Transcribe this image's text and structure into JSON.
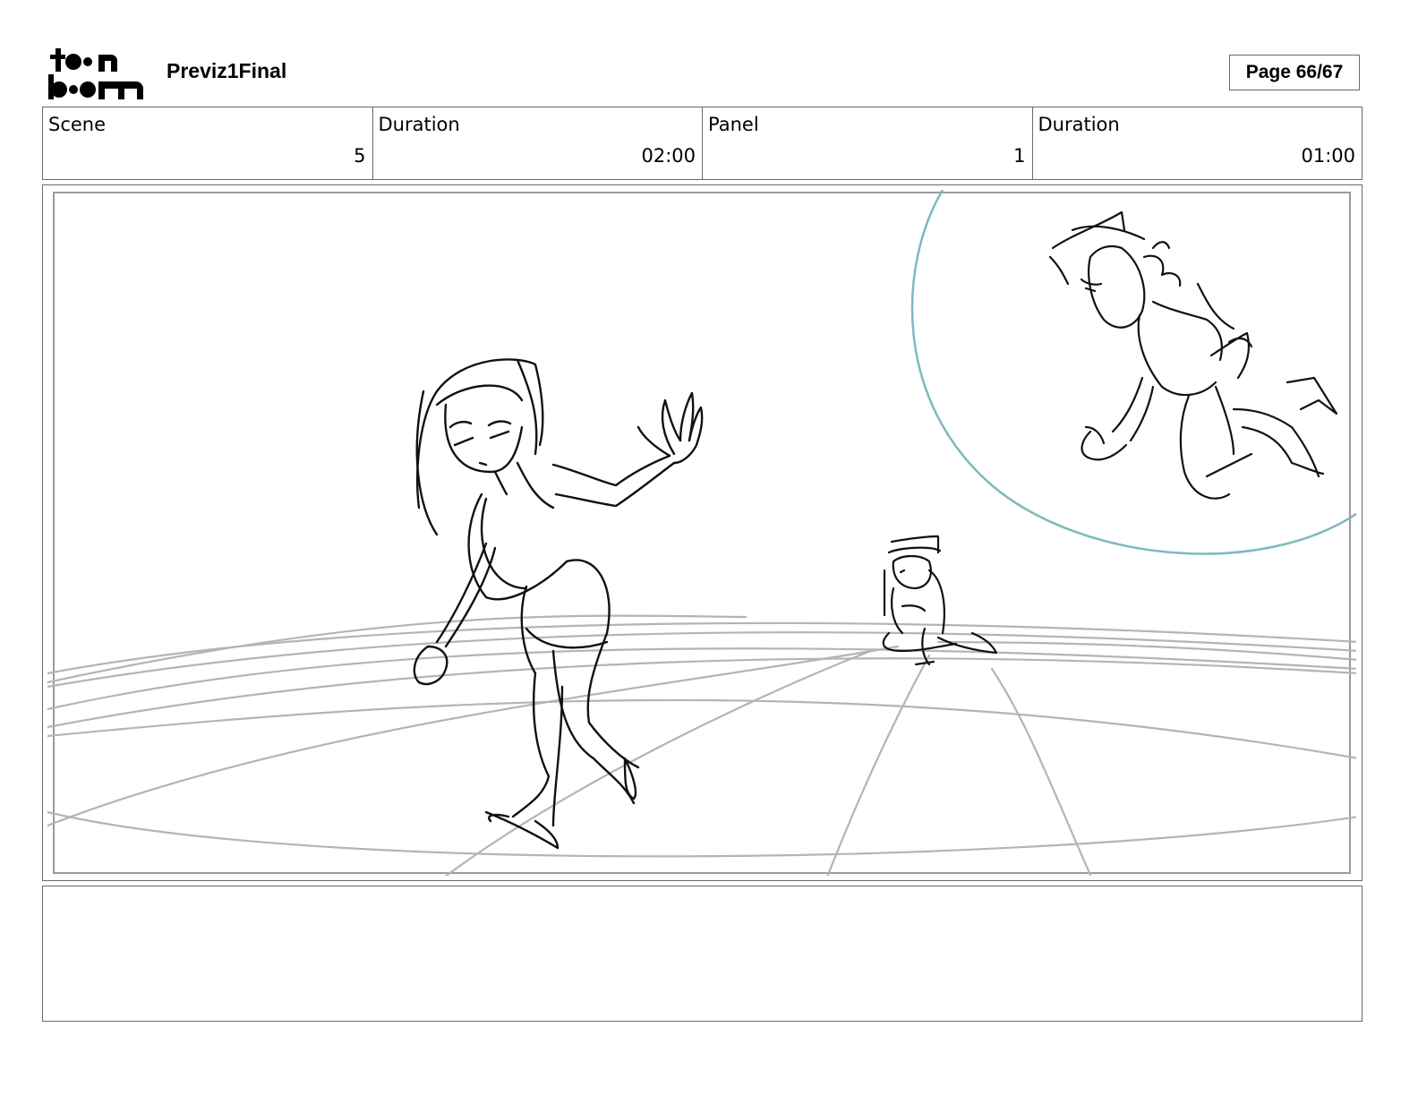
{
  "header": {
    "logo_text": "toon boom",
    "project_title": "Previz1Final",
    "page_label": "Page 66/67"
  },
  "info": {
    "scene_label": "Scene",
    "scene_value": "5",
    "scene_duration_label": "Duration",
    "scene_duration_value": "02:00",
    "panel_label": "Panel",
    "panel_value": "1",
    "panel_duration_label": "Duration",
    "panel_duration_value": "01:00"
  },
  "panel": {
    "sketch_icon": "storyboard-sketch",
    "bubble_color": "#7fb8bd",
    "grid_color": "#b4b4b4",
    "line_color": "#111111"
  },
  "notes": {
    "text": ""
  }
}
